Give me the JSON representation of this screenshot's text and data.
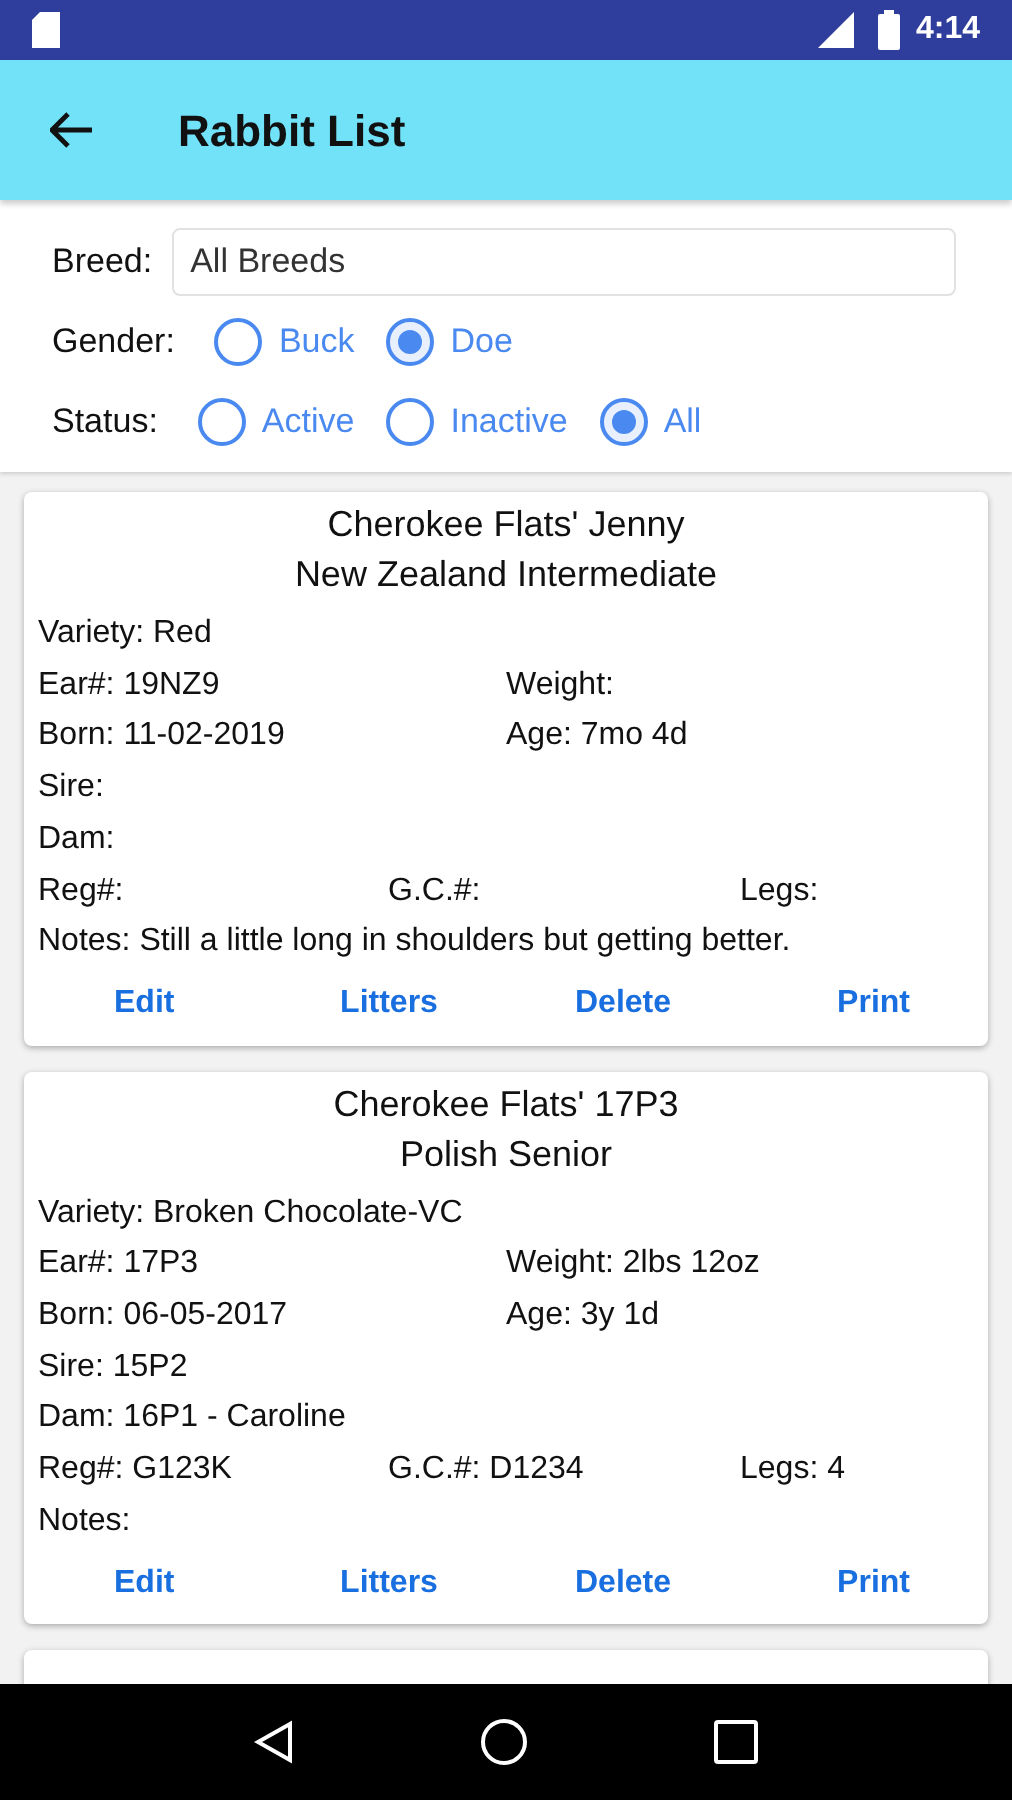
{
  "status_bar": {
    "time": "4:14"
  },
  "app_bar": {
    "title": "Rabbit List"
  },
  "filters": {
    "breed_label": "Breed:",
    "breed_value": "All Breeds",
    "gender_label": "Gender:",
    "gender_options": [
      {
        "label": "Buck",
        "selected": false
      },
      {
        "label": "Doe",
        "selected": true
      }
    ],
    "status_label": "Status:",
    "status_options": [
      {
        "label": "Active",
        "selected": false
      },
      {
        "label": "Inactive",
        "selected": false
      },
      {
        "label": "All",
        "selected": true
      }
    ]
  },
  "rabbits": [
    {
      "name": "Cherokee Flats' Jenny",
      "breed": "New Zealand Intermediate",
      "variety": "Variety: Red",
      "ear": "Ear#: 19NZ9",
      "weight": "Weight:",
      "born": "Born: 11-02-2019",
      "age": "Age: 7mo 4d",
      "sire": "Sire:",
      "dam": "Dam:",
      "reg": "Reg#:",
      "gc": "G.C.#:",
      "legs": "Legs:",
      "notes": "Notes: Still a little long in shoulders but getting better.",
      "actions": [
        "Edit",
        "Litters",
        "Delete",
        "Print"
      ]
    },
    {
      "name": "Cherokee Flats' 17P3",
      "breed": "Polish Senior",
      "variety": "Variety: Broken Chocolate-VC",
      "ear": "Ear#: 17P3",
      "weight": "Weight: 2lbs 12oz",
      "born": "Born: 06-05-2017",
      "age": "Age: 3y 1d",
      "sire": "Sire: 15P2",
      "dam": "Dam: 16P1 - Caroline",
      "reg": "Reg#: G123K",
      "gc": "G.C.#: D1234",
      "legs": "Legs: 4",
      "notes": "Notes:",
      "actions": [
        "Edit",
        "Litters",
        "Delete",
        "Print"
      ]
    }
  ]
}
